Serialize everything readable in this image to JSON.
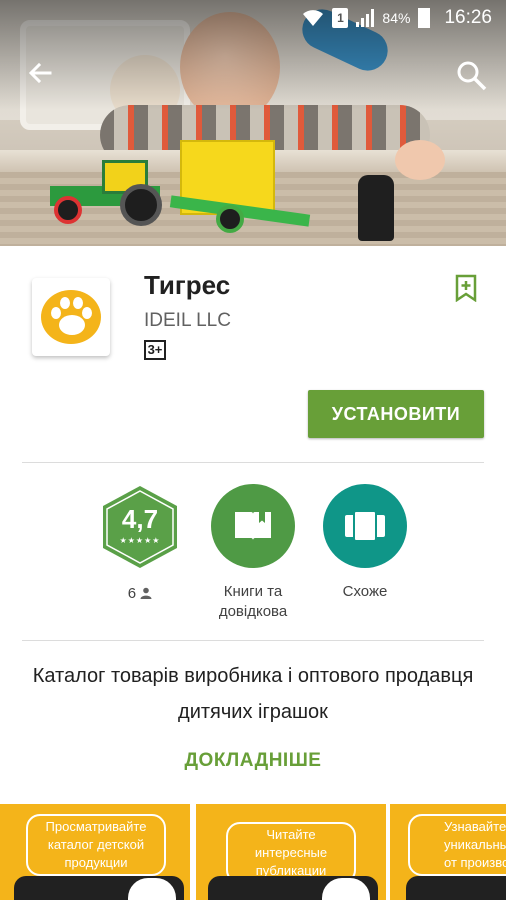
{
  "status_bar": {
    "battery": "84%",
    "sim": "1",
    "time": "16:26"
  },
  "app": {
    "title": "Тигрес",
    "developer": "IDEIL LLC",
    "age_rating": "3+",
    "install_label": "УСТАНОВИТИ"
  },
  "badges": {
    "rating": {
      "value": "4,7",
      "count": "6",
      "stars": "★★★★★"
    },
    "category": {
      "label": "Книги та довідкова"
    },
    "similar": {
      "label": "Схоже"
    }
  },
  "description": "Каталог товарів виробника і оптового продавця дитячих іграшок",
  "more_label": "ДОКЛАДНІШЕ",
  "screenshots": [
    {
      "caption": "Просматривайте каталог детской продукции"
    },
    {
      "caption": "Читайте интересные публикации"
    },
    {
      "caption": "Узнавайте про уникальные акции от производителя"
    }
  ],
  "colors": {
    "accent_green": "#689f38",
    "rating_green": "#5aa048",
    "category_green": "#4f9a45",
    "similar_teal": "#0f9688",
    "brand_orange": "#f4b41a"
  },
  "icons": [
    "back-arrow-icon",
    "search-icon",
    "wifi-icon",
    "signal-icon",
    "battery-icon",
    "wishlist-bookmark-icon",
    "book-icon",
    "cards-icon",
    "person-icon",
    "paw-icon"
  ]
}
